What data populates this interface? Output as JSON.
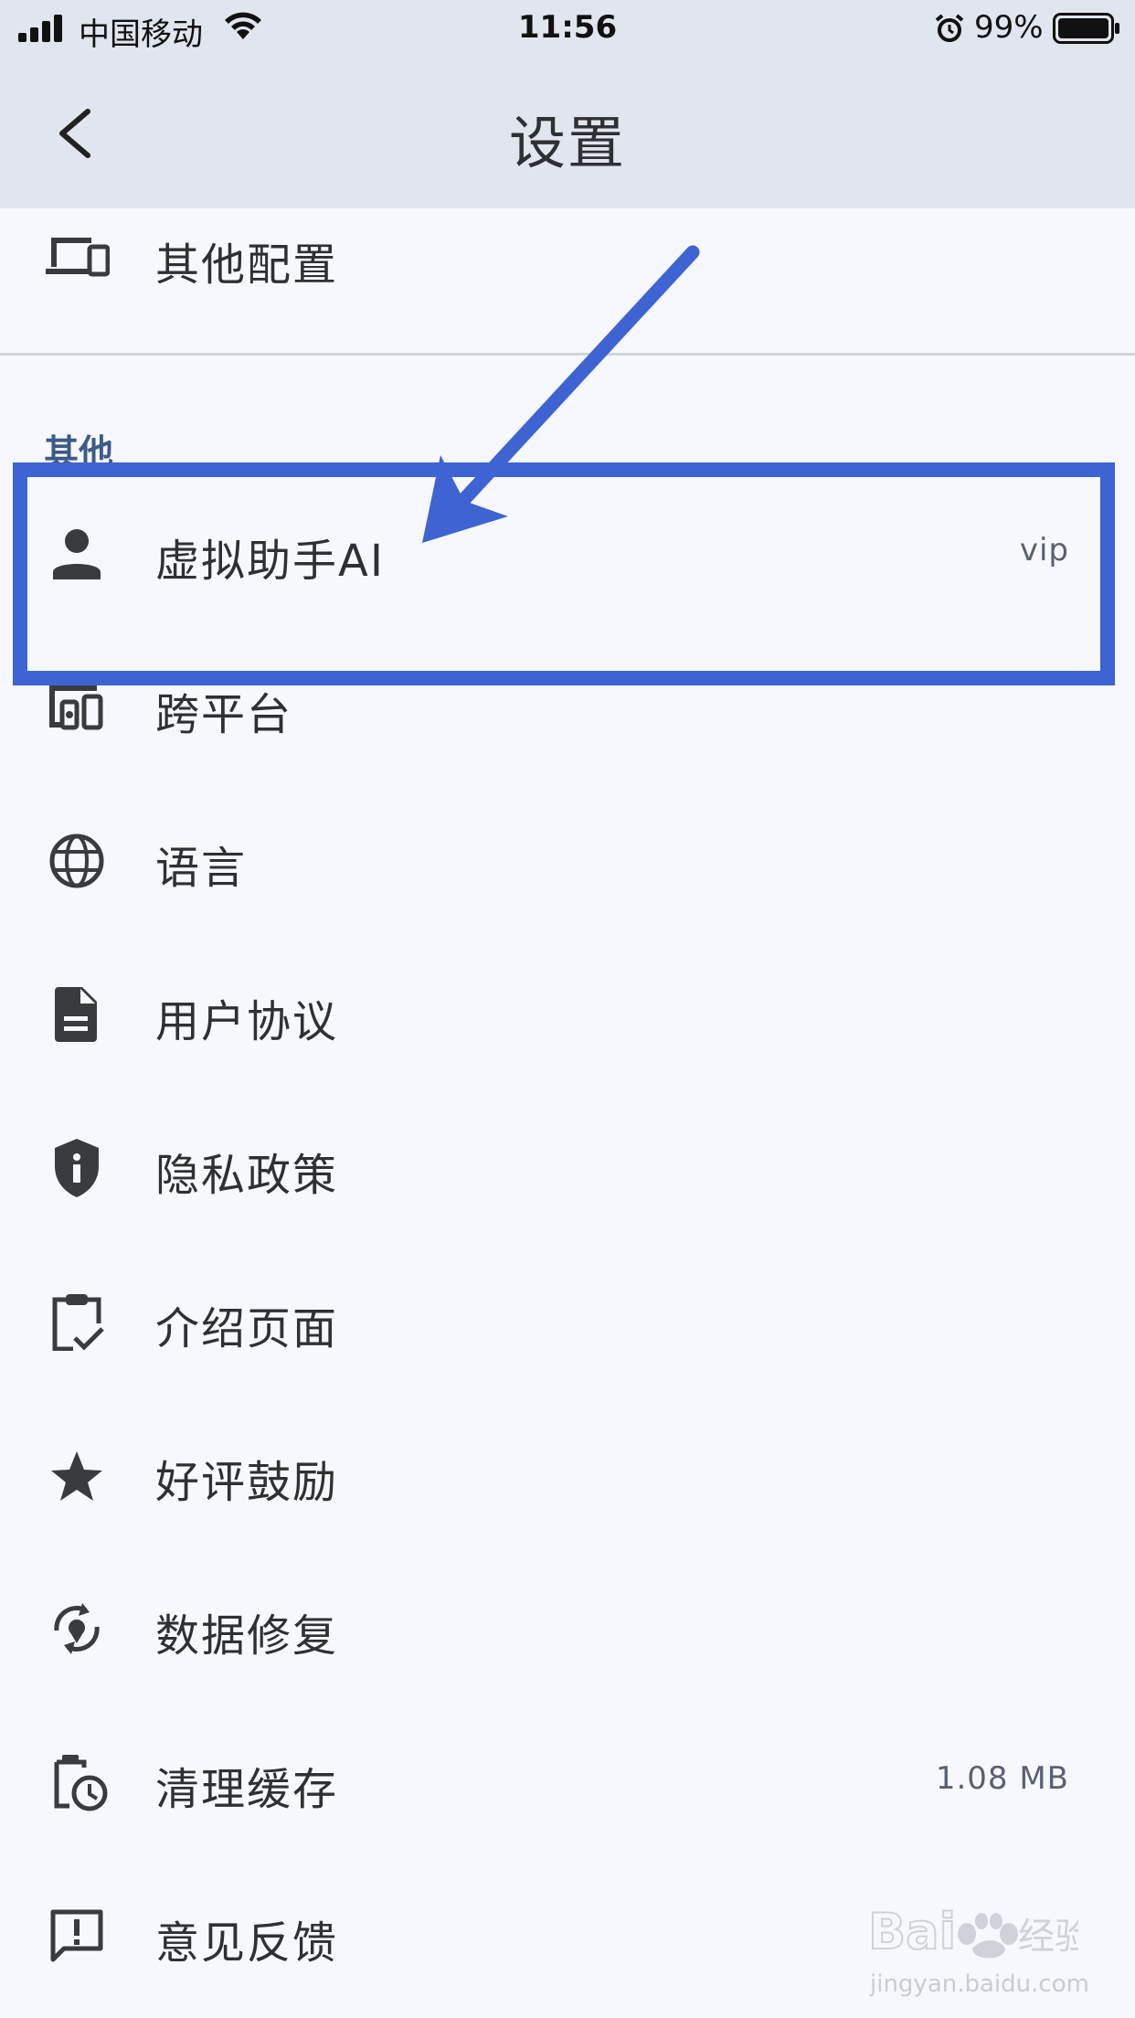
{
  "status_bar": {
    "carrier": "中国移动",
    "time": "11:56",
    "battery_percent": "99%"
  },
  "nav": {
    "title": "设置"
  },
  "top_item": {
    "label": "其他配置",
    "icon": "devices-icon"
  },
  "section": {
    "title": "其他"
  },
  "items": [
    {
      "label": "虚拟助手AI",
      "value": "vip",
      "icon": "person-icon"
    },
    {
      "label": "跨平台",
      "value": "",
      "icon": "multi-device-icon"
    },
    {
      "label": "语言",
      "value": "",
      "icon": "globe-icon"
    },
    {
      "label": "用户协议",
      "value": "",
      "icon": "document-icon"
    },
    {
      "label": "隐私政策",
      "value": "",
      "icon": "shield-info-icon"
    },
    {
      "label": "介绍页面",
      "value": "",
      "icon": "clipboard-check-icon"
    },
    {
      "label": "好评鼓励",
      "value": "",
      "icon": "star-icon"
    },
    {
      "label": "数据修复",
      "value": "",
      "icon": "repair-icon"
    },
    {
      "label": "清理缓存",
      "value": "1.08 MB",
      "icon": "clean-history-icon"
    },
    {
      "label": "意见反馈",
      "value": "",
      "icon": "feedback-icon"
    }
  ],
  "watermark": {
    "text": "jingyan.baidu.com"
  },
  "colors": {
    "header_bg": "#e1e5ee",
    "page_bg": "#f6f8fd",
    "annotation": "#3e63d2",
    "section_title": "#3d5a88"
  }
}
